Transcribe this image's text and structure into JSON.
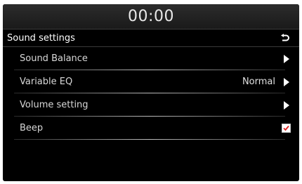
{
  "status_bar": {
    "clock": "00:00"
  },
  "header": {
    "title": "Sound settings",
    "back_icon": "back-return-icon"
  },
  "menu": {
    "items": [
      {
        "label": "Sound Balance",
        "value": "",
        "control": "arrow"
      },
      {
        "label": "Variable EQ",
        "value": "Normal",
        "control": "arrow"
      },
      {
        "label": "Volume setting",
        "value": "",
        "control": "arrow"
      },
      {
        "label": "Beep",
        "value": "",
        "control": "checkbox",
        "checked": true
      }
    ]
  },
  "colors": {
    "background": "#000000",
    "text": "#d8d8d8",
    "checkmark": "#e02020"
  }
}
